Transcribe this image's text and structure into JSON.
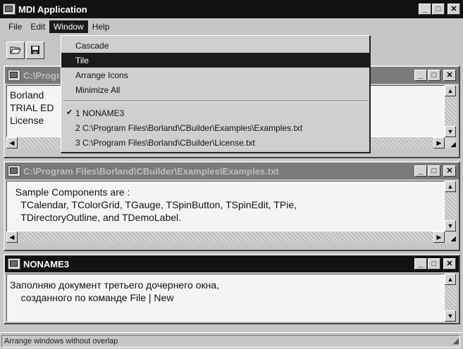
{
  "app": {
    "title": "MDI Application",
    "caption": {
      "minimize": "_",
      "maximize": "□",
      "close": "✕"
    }
  },
  "menubar": {
    "items": [
      {
        "label": "File"
      },
      {
        "label": "Edit"
      },
      {
        "label": "Window"
      },
      {
        "label": "Help"
      }
    ]
  },
  "toolbar": {
    "open_icon": "folder-open-icon",
    "save_icon": "floppy-disk-icon"
  },
  "window_menu": {
    "items": [
      {
        "label": "Cascade"
      },
      {
        "label": "Tile"
      },
      {
        "label": "Arrange Icons"
      },
      {
        "label": "Minimize All"
      }
    ],
    "windows": [
      {
        "label": "1 NONAME3",
        "checked": true
      },
      {
        "label": "2 C:\\Program Files\\Borland\\CBuilder\\Examples\\Examples.txt",
        "checked": false
      },
      {
        "label": "3 C:\\Program Files\\Borland\\CBuilder\\License.txt",
        "checked": false
      }
    ],
    "check_mark": "✔"
  },
  "children": [
    {
      "title": "C:\\Program Files\\Borland\\CBuilder\\License.txt",
      "lines": [
        "Borland",
        "TRIAL ED",
        "License"
      ]
    },
    {
      "title": "C:\\Program Files\\Borland\\CBuilder\\Examples\\Examples.txt",
      "lines": [
        "  Sample Components are :",
        "    TCalendar, TColorGrid, TGauge, TSpinButton, TSpinEdit, TPie,",
        "    TDirectoryOutline, and TDemoLabel."
      ]
    },
    {
      "title": "NONAME3",
      "lines": [
        "Заполняю документ третьего дочернего окна,",
        "    созданного по команде File | New"
      ]
    }
  ],
  "statusbar": {
    "text": "Arrange windows without overlap"
  }
}
